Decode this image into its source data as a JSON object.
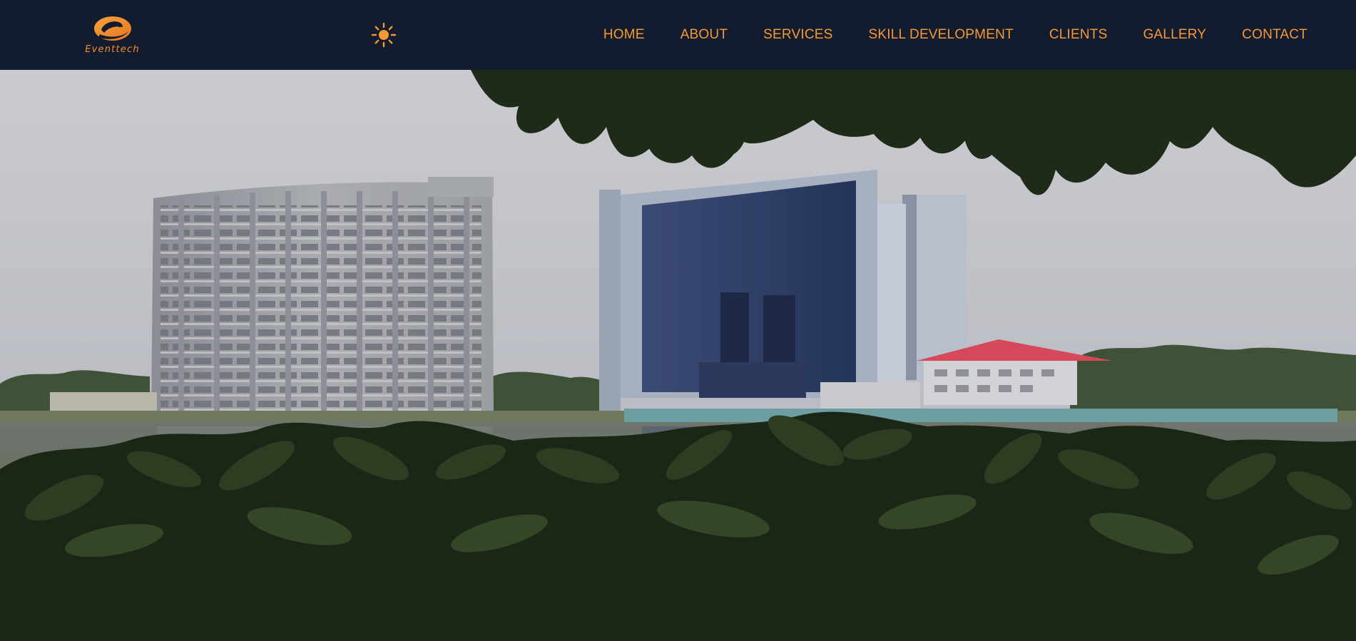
{
  "brand": {
    "name": "Eventtech",
    "logo_icon": "orange-e-swirl-logo",
    "accent_color": "#f59a33",
    "header_bg": "#131b2e"
  },
  "header": {
    "theme_toggle_icon": "sun-icon",
    "nav": [
      {
        "label": "HOME"
      },
      {
        "label": "ABOUT"
      },
      {
        "label": "SERVICES"
      },
      {
        "label": "SKILL DEVELOPMENT"
      },
      {
        "label": "CLIENTS"
      },
      {
        "label": "GALLERY"
      },
      {
        "label": "CONTACT"
      }
    ]
  },
  "hero": {
    "image_subject": "waterfront-buildings-with-foliage"
  }
}
